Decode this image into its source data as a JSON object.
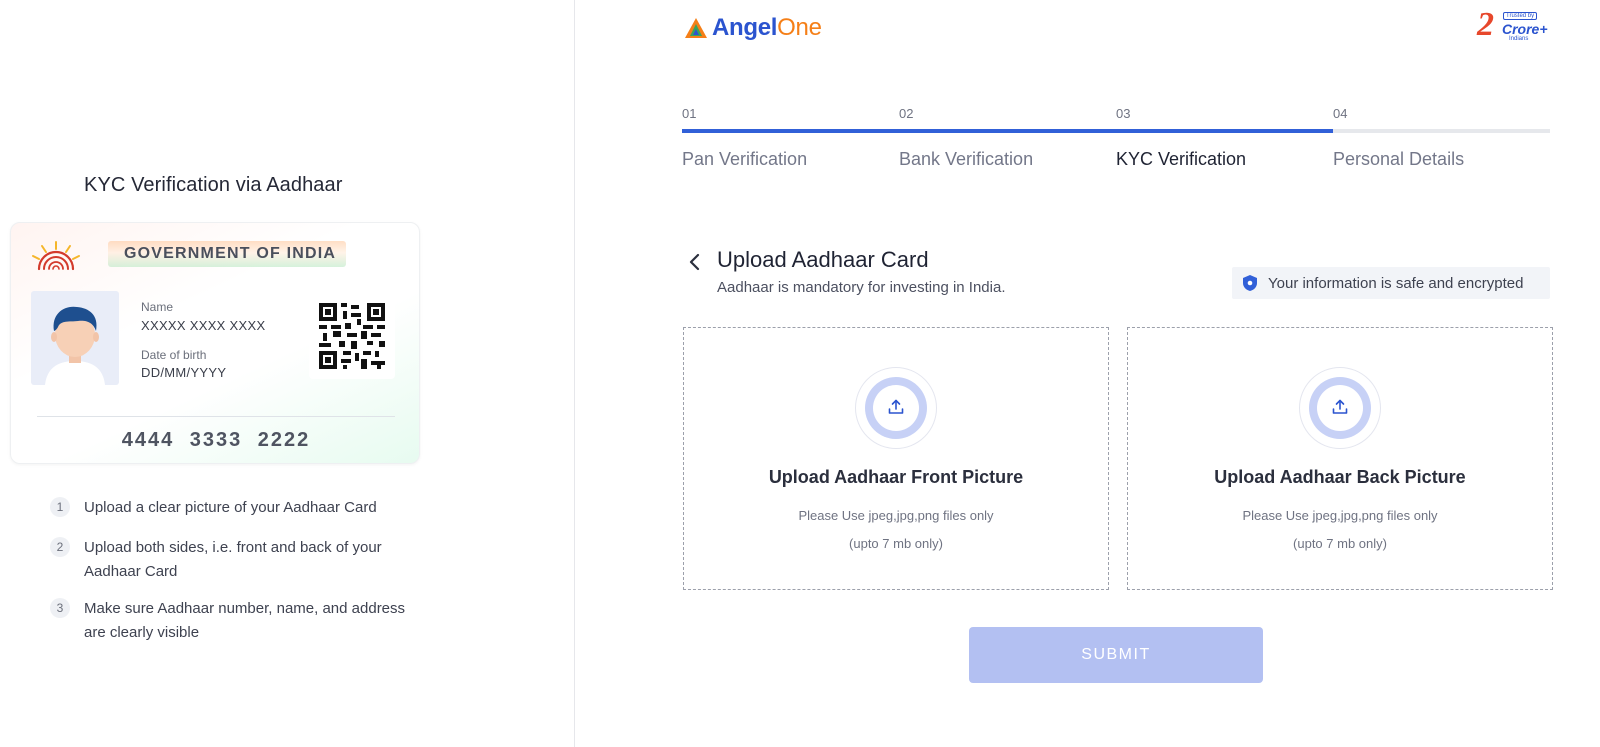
{
  "left": {
    "title": "KYC Verification via Aadhaar",
    "card": {
      "government": "GOVERNMENT OF INDIA",
      "name_label": "Name",
      "name_value": "XXXXX XXXX XXXX",
      "dob_label": "Date of birth",
      "dob_value": "DD/MM/YYYY",
      "number": "4444 3333 2222"
    },
    "instructions": [
      {
        "num": "1",
        "text": "Upload a clear picture of your Aadhaar Card"
      },
      {
        "num": "2",
        "text": "Upload both sides, i.e. front and back of your Aadhaar Card"
      },
      {
        "num": "3",
        "text": "Make sure Aadhaar number, name, and address are clearly visible"
      }
    ]
  },
  "header": {
    "logo_primary": "Angel",
    "logo_secondary": "One",
    "badge": {
      "number": "2",
      "trusted": "Trusted by",
      "crore": "Crore+",
      "indians": "Indians"
    }
  },
  "stepper": {
    "steps": [
      {
        "num": "01",
        "label": "Pan Verification",
        "state": "done"
      },
      {
        "num": "02",
        "label": "Bank Verification",
        "state": "done"
      },
      {
        "num": "03",
        "label": "KYC Verification",
        "state": "active"
      },
      {
        "num": "04",
        "label": "Personal Details",
        "state": "pending"
      }
    ]
  },
  "upload": {
    "title": "Upload Aadhaar Card",
    "subtitle": "Aadhaar is mandatory for investing in India.",
    "safe_text": "Your information is safe and encrypted",
    "front": {
      "title": "Upload Aadhaar Front Picture",
      "hint": "Please Use jpeg,jpg,png files only",
      "size": "(upto 7 mb only)"
    },
    "back": {
      "title": "Upload Aadhaar Back Picture",
      "hint": "Please Use jpeg,jpg,png files only",
      "size": "(upto 7 mb only)"
    },
    "submit_label": "SUBMIT"
  },
  "colors": {
    "brand_blue": "#3160d8",
    "brand_orange": "#f57f17",
    "submit_disabled": "#b3c0f2",
    "upload_ring": "#c7d1f6"
  },
  "icons": [
    "aadhaar-emblem-icon",
    "qr-code-icon",
    "back-chevron-icon",
    "shield-icon",
    "upload-icon",
    "angelone-logo-icon"
  ]
}
